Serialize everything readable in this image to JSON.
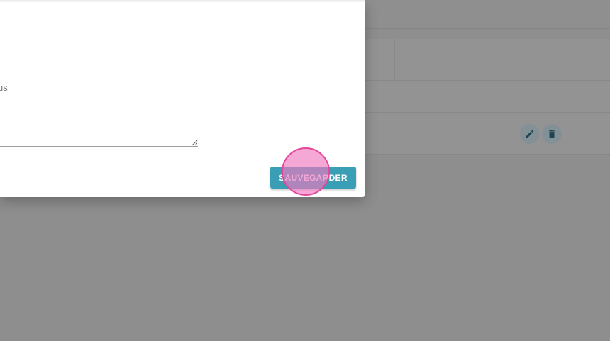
{
  "modal": {
    "field_label_fragment": "us",
    "textarea_value": "",
    "save_label": "SAUVEGARDER"
  },
  "table": {
    "row_actions": [
      "pencil-icon",
      "trash-icon"
    ]
  },
  "colors": {
    "accent": "#3a9fb4",
    "overlay": "#8e8e8e",
    "click_indicator": "#e4479a"
  }
}
